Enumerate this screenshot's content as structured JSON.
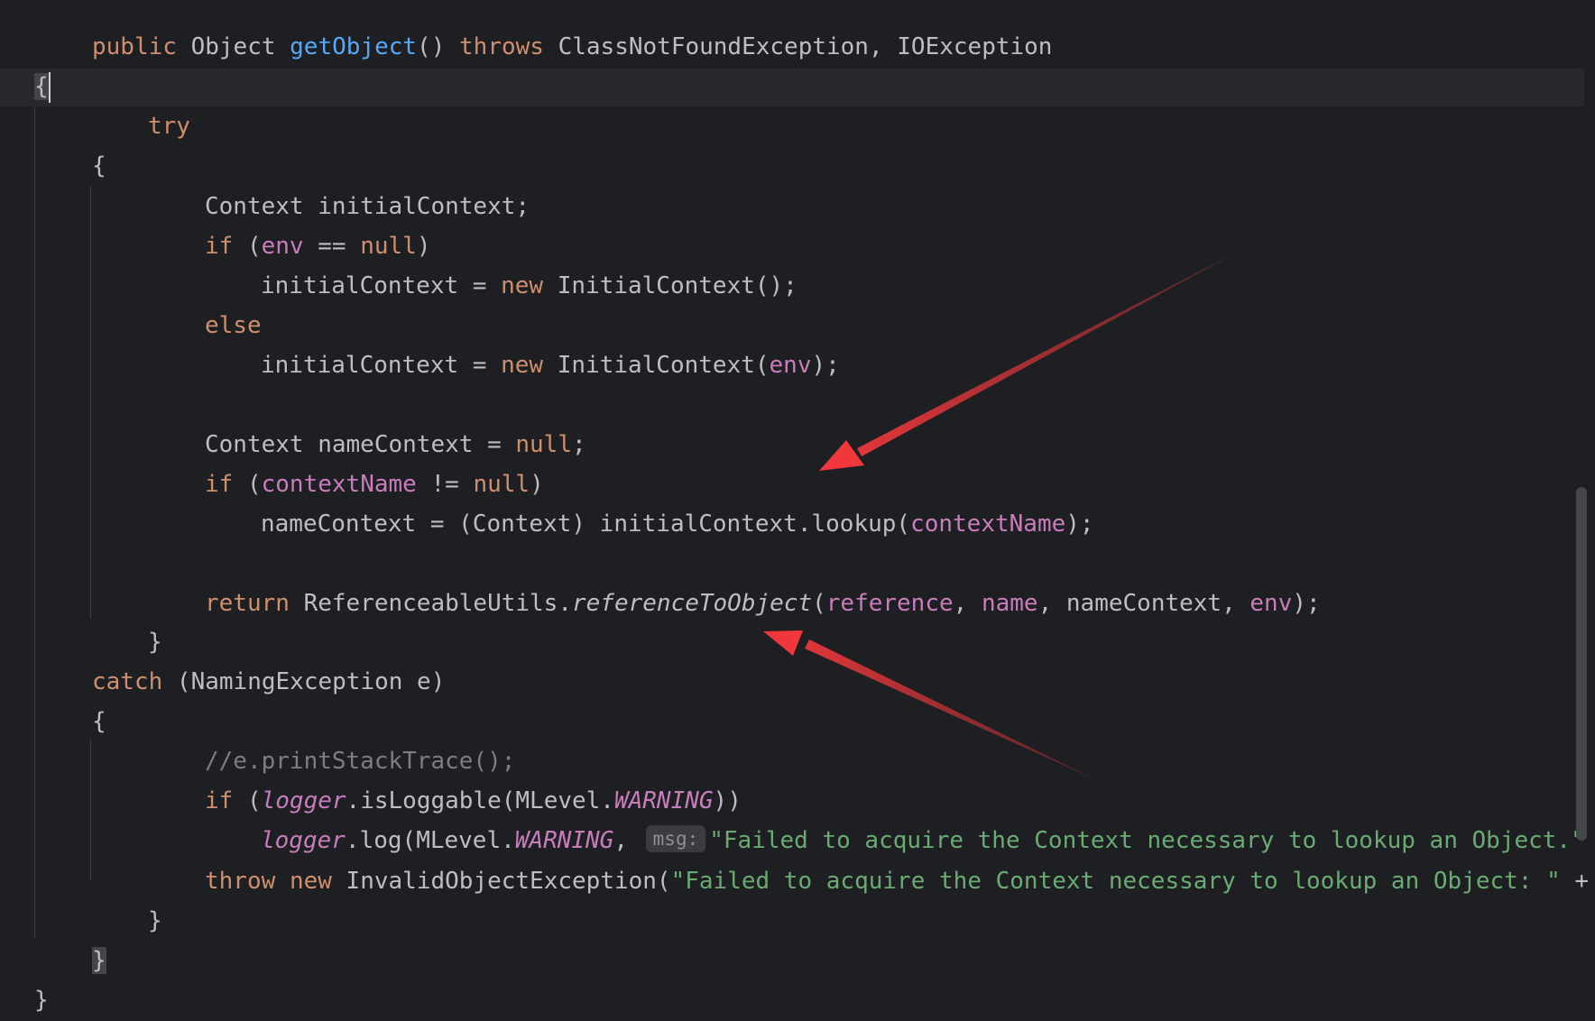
{
  "editor": {
    "annotation_color": "#f0383c",
    "lines": [
      {
        "tokens": [
          [
            "kw",
            "public"
          ],
          [
            "p",
            " Object "
          ],
          [
            "fn",
            "getObject"
          ],
          [
            "p",
            "() "
          ],
          [
            "kw",
            "throws"
          ],
          [
            "p",
            " ClassNotFoundException, IOException"
          ]
        ]
      },
      {
        "tokens": [
          [
            "p",
            "{"
          ]
        ]
      },
      {
        "tokens": [
          [
            "kw",
            "try"
          ]
        ]
      },
      {
        "tokens": [
          [
            "p",
            "{"
          ]
        ]
      },
      {
        "tokens": [
          [
            "p",
            "Context initialContext;"
          ]
        ]
      },
      {
        "tokens": [
          [
            "kw",
            "if"
          ],
          [
            "p",
            " ("
          ],
          [
            "fld",
            "env"
          ],
          [
            "p",
            " == "
          ],
          [
            "kw",
            "null"
          ],
          [
            "p",
            ")"
          ]
        ]
      },
      {
        "tokens": [
          [
            "p",
            "initialContext = "
          ],
          [
            "kw",
            "new"
          ],
          [
            "p",
            " InitialContext();"
          ]
        ]
      },
      {
        "tokens": [
          [
            "kw",
            "else"
          ]
        ]
      },
      {
        "tokens": [
          [
            "p",
            "initialContext = "
          ],
          [
            "kw",
            "new"
          ],
          [
            "p",
            " InitialContext("
          ],
          [
            "fld",
            "env"
          ],
          [
            "p",
            ");"
          ]
        ]
      },
      {
        "tokens": []
      },
      {
        "tokens": [
          [
            "p",
            "Context nameContext = "
          ],
          [
            "kw",
            "null"
          ],
          [
            "p",
            ";"
          ]
        ]
      },
      {
        "tokens": [
          [
            "kw",
            "if"
          ],
          [
            "p",
            " ("
          ],
          [
            "fld",
            "contextName"
          ],
          [
            "p",
            " != "
          ],
          [
            "kw",
            "null"
          ],
          [
            "p",
            ")"
          ]
        ]
      },
      {
        "tokens": [
          [
            "p",
            "nameContext = (Context) initialContext.lookup("
          ],
          [
            "fld",
            "contextName"
          ],
          [
            "p",
            ");"
          ]
        ]
      },
      {
        "tokens": []
      },
      {
        "tokens": [
          [
            "kw",
            "return"
          ],
          [
            "p",
            " ReferenceableUtils."
          ],
          [
            "it",
            "referenceToObject"
          ],
          [
            "p",
            "("
          ],
          [
            "fld",
            "reference"
          ],
          [
            "p",
            ", "
          ],
          [
            "fld",
            "name"
          ],
          [
            "p",
            ", nameContext, "
          ],
          [
            "fld",
            "env"
          ],
          [
            "p",
            ");"
          ]
        ]
      },
      {
        "tokens": [
          [
            "p",
            "}"
          ]
        ]
      },
      {
        "tokens": [
          [
            "kw",
            "catch"
          ],
          [
            "p",
            " (NamingException e)"
          ]
        ]
      },
      {
        "tokens": [
          [
            "p",
            "{"
          ]
        ]
      },
      {
        "tokens": [
          [
            "cmt",
            "//e.printStackTrace();"
          ]
        ]
      },
      {
        "tokens": [
          [
            "kw",
            "if"
          ],
          [
            "p",
            " ("
          ],
          [
            "fld-i",
            "logger"
          ],
          [
            "p",
            ".isLoggable(MLevel."
          ],
          [
            "fld-i",
            "WARNING"
          ],
          [
            "p",
            "))"
          ]
        ]
      },
      {
        "tokens": [
          [
            "fld-i",
            "logger"
          ],
          [
            "p",
            ".log(MLevel."
          ],
          [
            "fld-i",
            "WARNING"
          ],
          [
            "p",
            ", "
          ],
          [
            "hint",
            "msg:"
          ],
          [
            "str",
            "\"Failed to acquire the Context necessary to lookup an Object.\""
          ]
        ]
      },
      {
        "tokens": [
          [
            "kw",
            "throw"
          ],
          [
            "p",
            " "
          ],
          [
            "kw",
            "new"
          ],
          [
            "p",
            " InvalidObjectException("
          ],
          [
            "str",
            "\"Failed to acquire the Context necessary to lookup an Object: \""
          ],
          [
            "p",
            " +"
          ]
        ]
      },
      {
        "tokens": [
          [
            "p",
            "}"
          ]
        ]
      },
      {
        "tokens": [
          [
            "p",
            "}"
          ]
        ]
      },
      {
        "tokens": [
          [
            "p",
            "}"
          ]
        ]
      }
    ]
  }
}
